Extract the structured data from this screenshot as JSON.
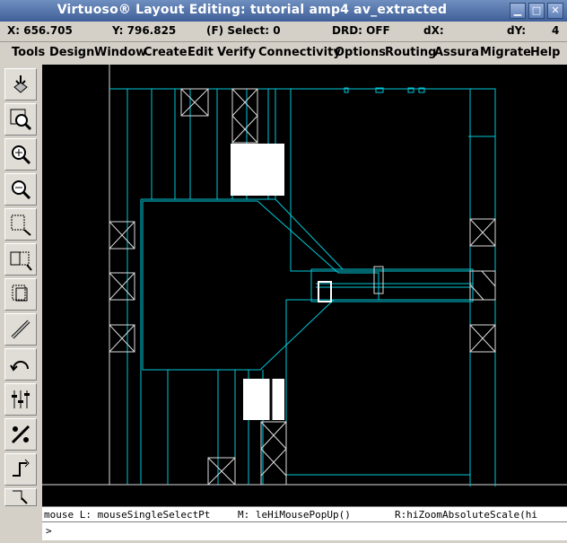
{
  "window": {
    "title": "Virtuoso® Layout Editing: tutorial amp4 av_extracted",
    "buttons": [
      "▁",
      "□",
      "✕"
    ]
  },
  "status": {
    "x": "X: 656.705",
    "y": "Y: 796.825",
    "select": "(F) Select: 0",
    "drd": "DRD: OFF",
    "dx": "dX:",
    "dy": "dY:",
    "count": "4"
  },
  "menu": [
    "Tools",
    "Design",
    "Window",
    "Create",
    "Edit",
    "Verify",
    "Connectivity",
    "Options",
    "Routing",
    "Assura",
    "Migrate",
    "Help"
  ],
  "toolbar_icons": [
    "save-icon",
    "zoom-fit-icon",
    "zoom-in-icon",
    "zoom-out-icon",
    "stretch-icon",
    "copy-icon",
    "move-icon",
    "path-icon",
    "undo-icon",
    "property-icon",
    "ruler-icon",
    "route-icon",
    "select-icon"
  ],
  "prompt": {
    "left": "mouse L: mouseSingleSelectPt",
    "middle": "M: leHiMousePopUp()",
    "right": "R:hiZoomAbsoluteScale(hi"
  },
  "cmd": {
    "text": ">"
  },
  "colors": {
    "canvas": "#000000",
    "shape": "#00c8d8",
    "highlight": "#ffffff"
  }
}
